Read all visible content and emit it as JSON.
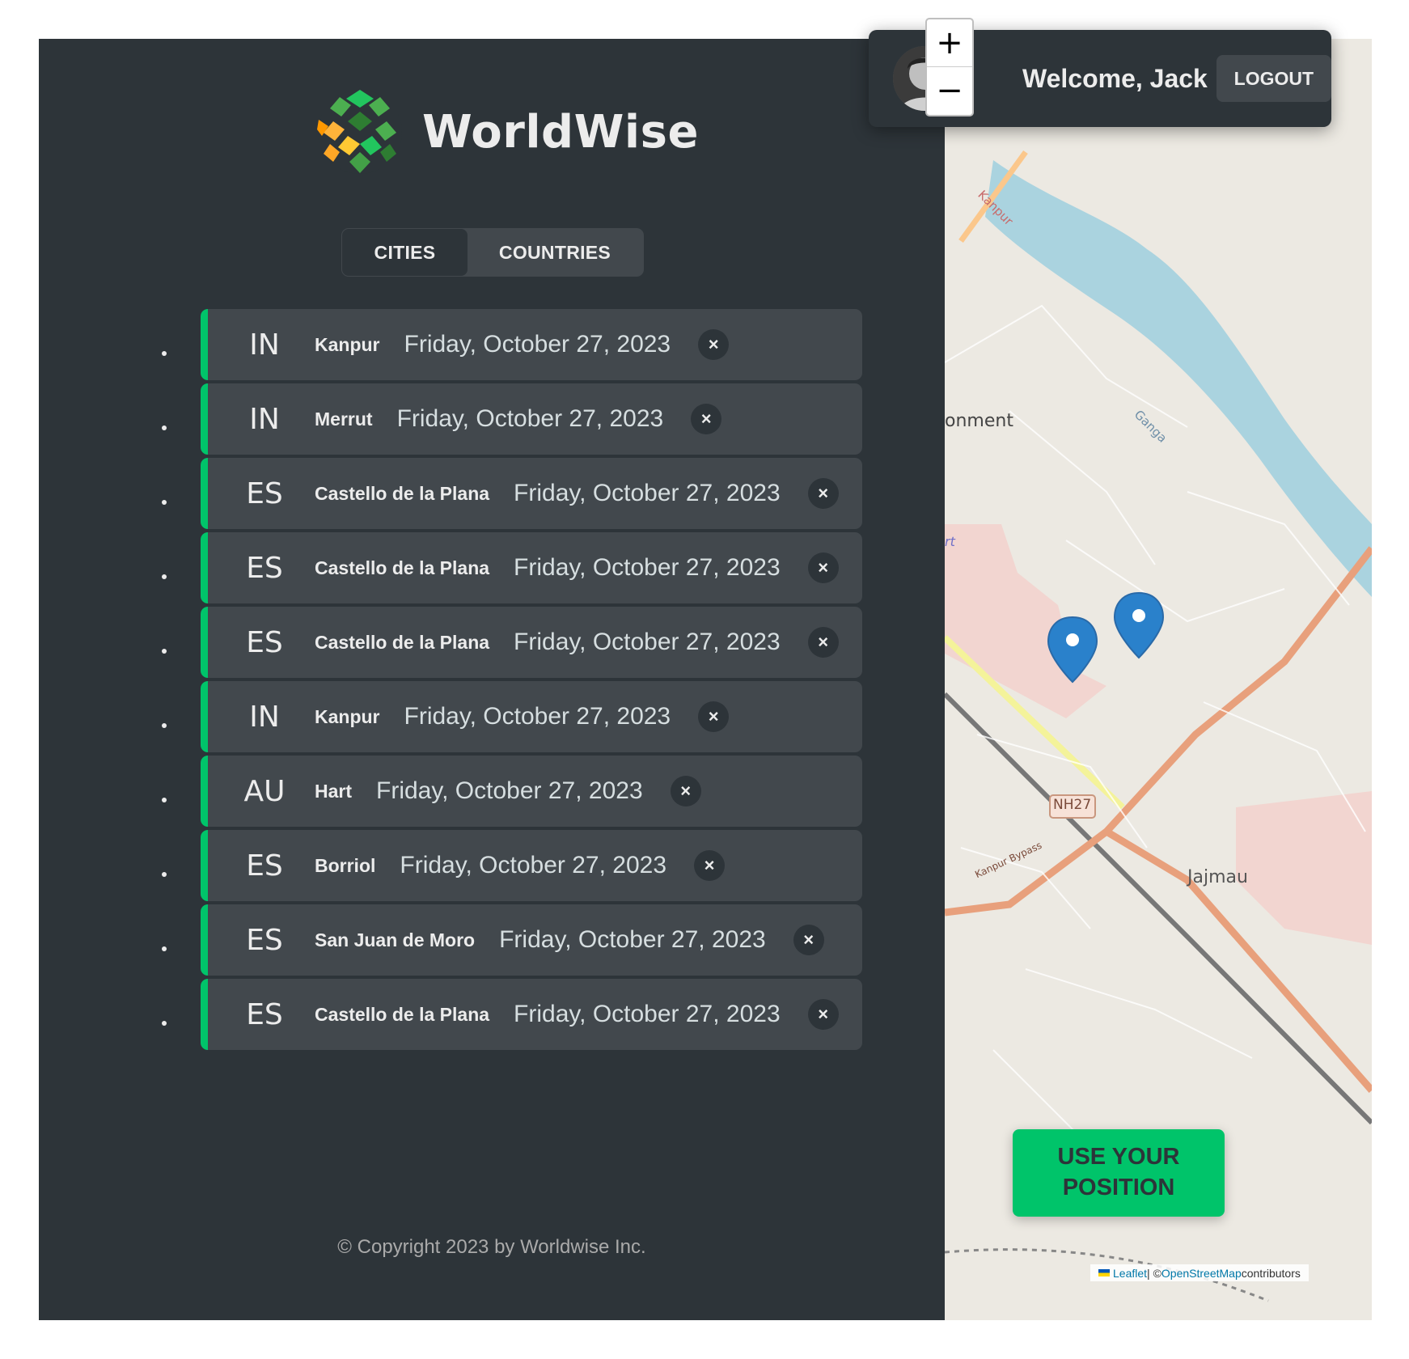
{
  "app": {
    "name": "WorldWise"
  },
  "tabs": [
    {
      "label": "CITIES",
      "active": true
    },
    {
      "label": "COUNTRIES",
      "active": false
    }
  ],
  "cities": [
    {
      "country_code": "IN",
      "name": "Kanpur",
      "date": "Friday, October 27, 2023"
    },
    {
      "country_code": "IN",
      "name": "Merrut",
      "date": "Friday, October 27, 2023"
    },
    {
      "country_code": "ES",
      "name": "Castello de la Plana",
      "date": "Friday, October 27, 2023"
    },
    {
      "country_code": "ES",
      "name": "Castello de la Plana",
      "date": "Friday, October 27, 2023"
    },
    {
      "country_code": "ES",
      "name": "Castello de la Plana",
      "date": "Friday, October 27, 2023"
    },
    {
      "country_code": "IN",
      "name": "Kanpur",
      "date": "Friday, October 27, 2023"
    },
    {
      "country_code": "AU",
      "name": "Hart",
      "date": "Friday, October 27, 2023"
    },
    {
      "country_code": "ES",
      "name": "Borriol",
      "date": "Friday, October 27, 2023"
    },
    {
      "country_code": "ES",
      "name": "San Juan de Moro",
      "date": "Friday, October 27, 2023"
    },
    {
      "country_code": "ES",
      "name": "Castello de la Plana",
      "date": "Friday, October 27, 2023"
    }
  ],
  "delete_icon": "×",
  "footer": {
    "copyright": "© Copyright 2023 by Worldwise Inc."
  },
  "user": {
    "welcome": "Welcome, Jack",
    "logout_label": "LOGOUT"
  },
  "map": {
    "zoom_in": "+",
    "zoom_out": "−",
    "use_position_label": "USE YOUR POSITION",
    "labels": [
      "onment",
      "Ganga",
      "Kanpur",
      "NH27",
      "Kanpur Bypass",
      "Jajmau",
      "rt"
    ],
    "attribution": {
      "leaflet": "Leaflet",
      "separator": " | © ",
      "osm": "OpenStreetMap",
      "suffix": " contributors"
    }
  },
  "colors": {
    "brand_green": "#00c46a",
    "dark_bg": "#2d3439",
    "card_bg": "#42484d",
    "marker_blue": "#2a81cb"
  }
}
